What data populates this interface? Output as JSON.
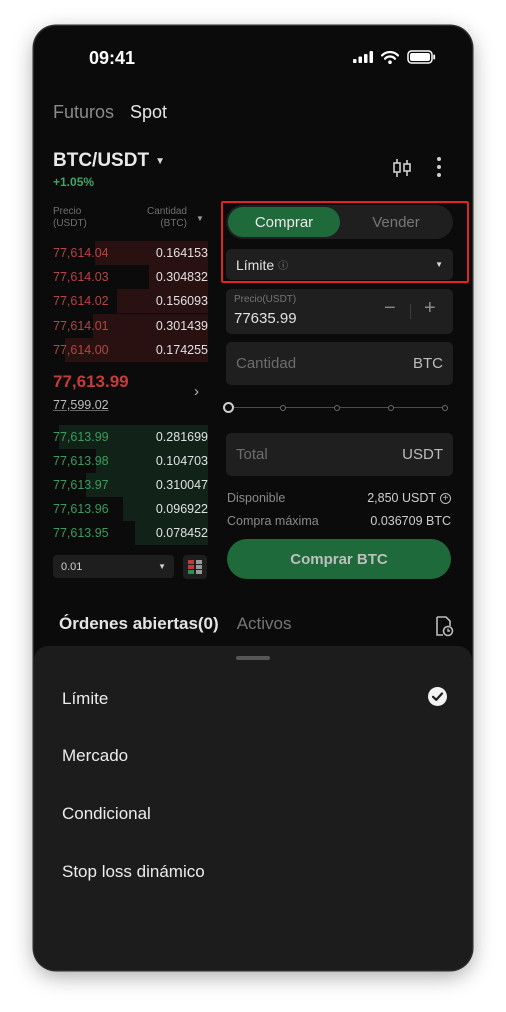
{
  "status_bar": {
    "time": "09:41"
  },
  "market_tabs": [
    {
      "label": "Futuros",
      "active": false
    },
    {
      "label": "Spot",
      "active": true
    }
  ],
  "pair": {
    "symbol": "BTC/USDT",
    "change": "+1.05%"
  },
  "orderbook": {
    "header_price": "Precio\n(USDT)",
    "header_qty": "Cantidad\n(BTC)",
    "asks": [
      {
        "price": "77,614.04",
        "qty": "0.164153",
        "depth": 0.73
      },
      {
        "price": "77,614.03",
        "qty": "0.304832",
        "depth": 0.38
      },
      {
        "price": "77,614.02",
        "qty": "0.156093",
        "depth": 0.59
      },
      {
        "price": "77,614.01",
        "qty": "0.301439",
        "depth": 0.74
      },
      {
        "price": "77,614.00",
        "qty": "0.174255",
        "depth": 0.92
      }
    ],
    "mid_price": "77,613.99",
    "mid_sub": "77,599.02",
    "bids": [
      {
        "price": "77,613.99",
        "qty": "0.281699",
        "depth": 0.96
      },
      {
        "price": "77,613.98",
        "qty": "0.104703",
        "depth": 0.72
      },
      {
        "price": "77,613.97",
        "qty": "0.310047",
        "depth": 0.79
      },
      {
        "price": "77,613.96",
        "qty": "0.096922",
        "depth": 0.55
      },
      {
        "price": "77,613.95",
        "qty": "0.078452",
        "depth": 0.47
      }
    ],
    "depth_step": "0.01"
  },
  "order_form": {
    "buy_label": "Comprar",
    "sell_label": "Vender",
    "order_type": "Límite",
    "price_label": "Precio(USDT)",
    "price_value": "77635.99",
    "price_minus": "−",
    "price_plus": "+",
    "qty_placeholder": "Cantidad",
    "qty_unit": "BTC",
    "total_placeholder": "Total",
    "total_unit": "USDT",
    "available_label": "Disponible",
    "available_value": "2,850 USDT",
    "max_label": "Compra máxima",
    "max_value": "0.036709 BTC",
    "submit_label": "Comprar BTC"
  },
  "orders_tabs": [
    {
      "label": "Órdenes abiertas(0)",
      "active": true
    },
    {
      "label": "Activos",
      "active": false
    }
  ],
  "sheet": {
    "items": [
      "Límite",
      "Mercado",
      "Condicional",
      "Stop loss dinámico"
    ],
    "selected": "Límite"
  },
  "colors": {
    "accent_green": "#1f6a3b",
    "ask_red": "#b54444",
    "bid_green": "#3f9a5e",
    "highlight_red": "#e02424"
  }
}
